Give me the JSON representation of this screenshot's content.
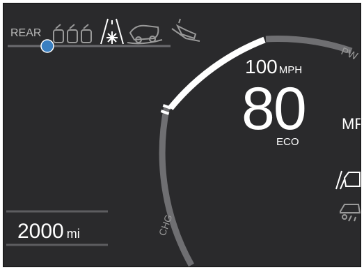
{
  "drive_rear_label": "REAR",
  "speed_limit": {
    "value": "100",
    "unit": "MPH"
  },
  "speed": {
    "value": "80",
    "unit": "MP",
    "mode": "ECO"
  },
  "gauge": {
    "top_label": "PW",
    "bottom_label": "CHG"
  },
  "odometer": {
    "value": "2000",
    "unit": "mi"
  },
  "slider": {
    "level": 0.12,
    "knob_color": "#3a7fc1"
  },
  "icons": [
    "rear-wheel-drive-icon",
    "snow-road-icon",
    "offroad-vehicle-icon",
    "hill-descent-icon",
    "lane-keep-icon",
    "driver-attention-icon"
  ],
  "colors": {
    "panel": "#2a2a2c",
    "arc_active": "#ffffff",
    "arc_inactive": "#7a7a7a"
  }
}
